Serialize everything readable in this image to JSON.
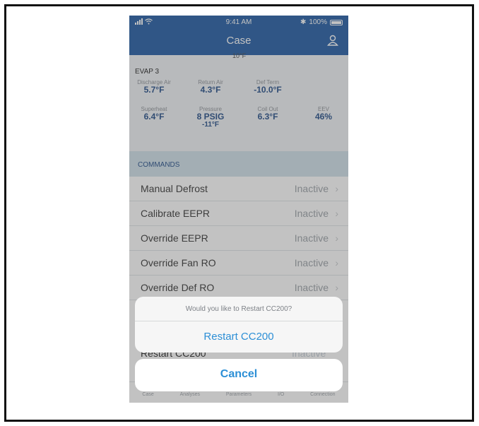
{
  "status": {
    "time": "9:41 AM",
    "battery": "100%"
  },
  "nav": {
    "title": "Case"
  },
  "readings": {
    "cut_value": "10°F",
    "title": "EVAP 3",
    "discharge_air": {
      "label": "Discharge Air",
      "value": "5.7°F"
    },
    "return_air": {
      "label": "Return Air",
      "value": "4.3°F"
    },
    "def_term": {
      "label": "Def Term",
      "value": "-10.0°F"
    },
    "superheat": {
      "label": "Superheat",
      "value": "6.4°F"
    },
    "pressure": {
      "label": "Pressure",
      "value": "8 PSIG",
      "sub": "-11°F"
    },
    "coil_out": {
      "label": "Coil Out",
      "value": "6.3°F"
    },
    "eev": {
      "label": "EEV",
      "value": "46%"
    }
  },
  "commands": {
    "header": "COMMANDS",
    "items": [
      {
        "name": "Manual Defrost",
        "state": "Inactive"
      },
      {
        "name": "Calibrate EEPR",
        "state": "Inactive"
      },
      {
        "name": "Override EEPR",
        "state": "Inactive"
      },
      {
        "name": "Override Fan RO",
        "state": "Inactive"
      },
      {
        "name": "Override Def RO",
        "state": "Inactive"
      }
    ],
    "hidden_row": {
      "name": "Restart CC200",
      "state": "Inactive"
    }
  },
  "tabs": [
    "Case",
    "Analyses",
    "Parameters",
    "I/O",
    "Connection"
  ],
  "sheet": {
    "message": "Would you like to Restart CC200?",
    "action": "Restart CC200",
    "cancel": "Cancel"
  },
  "colors": {
    "nav": "#1f5aa3",
    "accent": "#2c8fd6",
    "value": "#1f4a86"
  }
}
